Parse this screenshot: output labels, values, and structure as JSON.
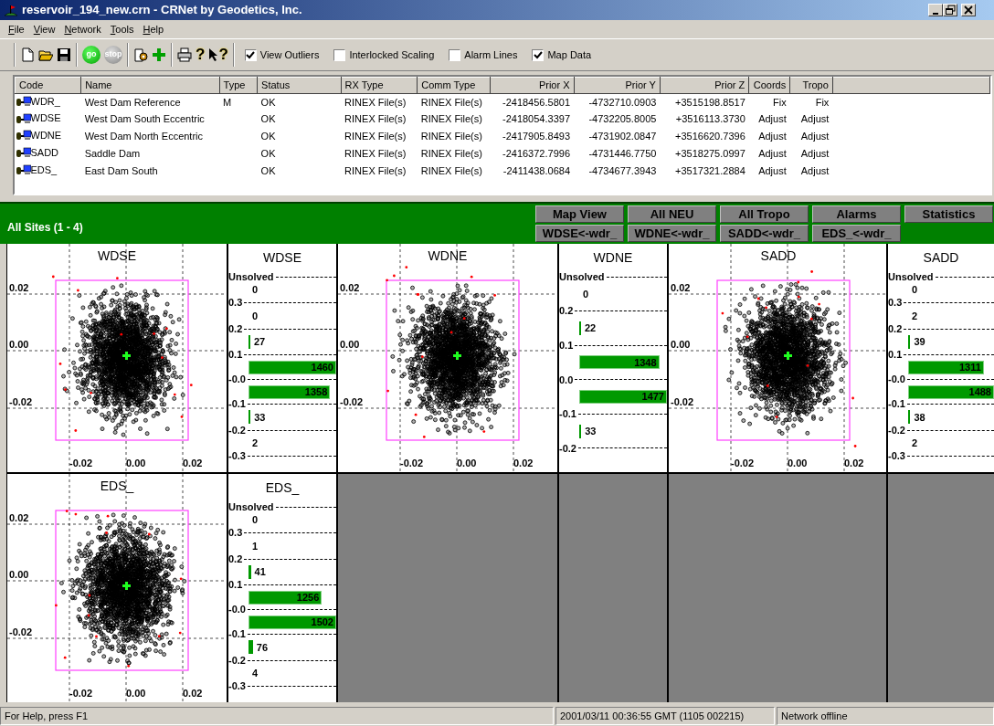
{
  "window": {
    "title": "reservoir_194_new.crn - CRNet by Geodetics, Inc."
  },
  "menu": [
    "File",
    "View",
    "Network",
    "Tools",
    "Help"
  ],
  "toolbar": [
    {
      "kind": "new"
    },
    {
      "kind": "open"
    },
    {
      "kind": "save"
    },
    {
      "kind": "sep"
    },
    {
      "kind": "go",
      "label": "go"
    },
    {
      "kind": "stop",
      "label": "stop"
    },
    {
      "kind": "sep"
    },
    {
      "kind": "wizard"
    },
    {
      "kind": "add"
    },
    {
      "kind": "sep"
    },
    {
      "kind": "print"
    },
    {
      "kind": "help",
      "label": "?"
    },
    {
      "kind": "whatsthis",
      "label": "?"
    },
    {
      "kind": "sep"
    }
  ],
  "options": [
    {
      "label": "View Outliers",
      "checked": true
    },
    {
      "label": "Interlocked Scaling",
      "checked": false
    },
    {
      "label": "Alarm Lines",
      "checked": false
    },
    {
      "label": "Map Data",
      "checked": true
    }
  ],
  "table": {
    "columns": [
      "Code",
      "Name",
      "Type",
      "Status",
      "RX Type",
      "Comm Type",
      "Prior X",
      "Prior Y",
      "Prior Z",
      "Coords",
      "Tropo"
    ],
    "rows": [
      [
        "WDR_",
        "West Dam Reference",
        "M",
        "OK",
        "RINEX File(s)",
        "RINEX File(s)",
        "-2418456.5801",
        "-4732710.0903",
        "+3515198.8517",
        "Fix",
        "Fix"
      ],
      [
        "WDSE",
        "West Dam South Eccentric",
        "",
        "OK",
        "RINEX File(s)",
        "RINEX File(s)",
        "-2418054.3397",
        "-4732205.8005",
        "+3516113.3730",
        "Adjust",
        "Adjust"
      ],
      [
        "WDNE",
        "West Dam North Eccentric",
        "",
        "OK",
        "RINEX File(s)",
        "RINEX File(s)",
        "-2417905.8493",
        "-4731902.0847",
        "+3516620.7396",
        "Adjust",
        "Adjust"
      ],
      [
        "SADD",
        "Saddle Dam",
        "",
        "OK",
        "RINEX File(s)",
        "RINEX File(s)",
        "-2416372.7996",
        "-4731446.7750",
        "+3518275.0997",
        "Adjust",
        "Adjust"
      ],
      [
        "EDS_",
        "East Dam South",
        "",
        "OK",
        "RINEX File(s)",
        "RINEX File(s)",
        "-2411438.0684",
        "-4734677.3943",
        "+3517321.2884",
        "Adjust",
        "Adjust"
      ]
    ]
  },
  "sites_bar": {
    "title": "All Sites (1 - 4)",
    "buttons": [
      "Map View",
      "All NEU",
      "All Tropo",
      "Alarms",
      "Statistics"
    ],
    "baselines": [
      "WDSE<-wdr_",
      "WDNE<-wdr_",
      "SADD<-wdr_",
      "EDS_<-wdr_"
    ]
  },
  "panels": [
    {
      "kind": "scatter",
      "title": "WDSE",
      "yticks": [
        "0.02",
        "0.00",
        "-0.02"
      ],
      "xticks": [
        "-0.02",
        "0.00",
        "0.02"
      ]
    },
    {
      "kind": "histogram",
      "title": "WDSE",
      "rows": [
        {
          "kind": "line",
          "label": "Unsolved"
        },
        {
          "kind": "bin",
          "count": "0"
        },
        {
          "kind": "line",
          "label": "0.3"
        },
        {
          "kind": "bin",
          "count": "0"
        },
        {
          "kind": "line",
          "label": "0.2"
        },
        {
          "kind": "bin",
          "count": "27"
        },
        {
          "kind": "line",
          "label": "0.1"
        },
        {
          "kind": "bin",
          "count": "1460"
        },
        {
          "kind": "line",
          "label": "-0.0"
        },
        {
          "kind": "bin",
          "count": "1358"
        },
        {
          "kind": "line",
          "label": "-0.1"
        },
        {
          "kind": "bin",
          "count": "33"
        },
        {
          "kind": "line",
          "label": "-0.2"
        },
        {
          "kind": "bin",
          "count": "2"
        },
        {
          "kind": "line",
          "label": "-0.3"
        }
      ]
    },
    {
      "kind": "scatter",
      "title": "WDNE",
      "yticks": [
        "0.02",
        "0.00",
        "-0.02"
      ],
      "xticks": [
        "-0.02",
        "0.00",
        "0.02"
      ]
    },
    {
      "kind": "histogram",
      "title": "WDNE",
      "rows": [
        {
          "kind": "line",
          "label": "Unsolved"
        },
        {
          "kind": "bin",
          "count": "0"
        },
        {
          "kind": "line",
          "label": "0.2"
        },
        {
          "kind": "bin",
          "count": "22"
        },
        {
          "kind": "line",
          "label": "0.1"
        },
        {
          "kind": "bin",
          "count": "1348"
        },
        {
          "kind": "line",
          "label": "0.0"
        },
        {
          "kind": "bin",
          "count": "1477"
        },
        {
          "kind": "line",
          "label": "-0.1"
        },
        {
          "kind": "bin",
          "count": "33"
        },
        {
          "kind": "line",
          "label": "-0.2"
        }
      ]
    },
    {
      "kind": "scatter",
      "title": "SADD",
      "yticks": [
        "0.02",
        "0.00",
        "-0.02"
      ],
      "xticks": [
        "-0.02",
        "0.00",
        "0.02"
      ]
    },
    {
      "kind": "histogram",
      "title": "SADD",
      "rows": [
        {
          "kind": "line",
          "label": "Unsolved"
        },
        {
          "kind": "bin",
          "count": "0"
        },
        {
          "kind": "line",
          "label": "0.3"
        },
        {
          "kind": "bin",
          "count": "2"
        },
        {
          "kind": "line",
          "label": "0.2"
        },
        {
          "kind": "bin",
          "count": "39"
        },
        {
          "kind": "line",
          "label": "0.1"
        },
        {
          "kind": "bin",
          "count": "1311"
        },
        {
          "kind": "line",
          "label": "-0.0"
        },
        {
          "kind": "bin",
          "count": "1488"
        },
        {
          "kind": "line",
          "label": "-0.1"
        },
        {
          "kind": "bin",
          "count": "38"
        },
        {
          "kind": "line",
          "label": "-0.2"
        },
        {
          "kind": "bin",
          "count": "2"
        },
        {
          "kind": "line",
          "label": "-0.3"
        }
      ]
    },
    {
      "kind": "scatter",
      "title": "EDS_",
      "yticks": [
        "0.02",
        "0.00",
        "-0.02"
      ],
      "xticks": [
        "-0.02",
        "0.00",
        "0.02"
      ]
    },
    {
      "kind": "histogram",
      "title": "EDS_",
      "rows": [
        {
          "kind": "line",
          "label": "Unsolved"
        },
        {
          "kind": "bin",
          "count": "0"
        },
        {
          "kind": "line",
          "label": "0.3"
        },
        {
          "kind": "bin",
          "count": "1"
        },
        {
          "kind": "line",
          "label": "0.2"
        },
        {
          "kind": "bin",
          "count": "41"
        },
        {
          "kind": "line",
          "label": "0.1"
        },
        {
          "kind": "bin",
          "count": "1256"
        },
        {
          "kind": "line",
          "label": "-0.0"
        },
        {
          "kind": "bin",
          "count": "1502"
        },
        {
          "kind": "line",
          "label": "-0.1"
        },
        {
          "kind": "bin",
          "count": "76"
        },
        {
          "kind": "line",
          "label": "-0.2"
        },
        {
          "kind": "bin",
          "count": "4"
        },
        {
          "kind": "line",
          "label": "-0.3"
        }
      ]
    }
  ],
  "status_bar": [
    "For Help, press F1",
    "2001/03/11 00:36:55 GMT (1105 002215)",
    "Network offline"
  ]
}
